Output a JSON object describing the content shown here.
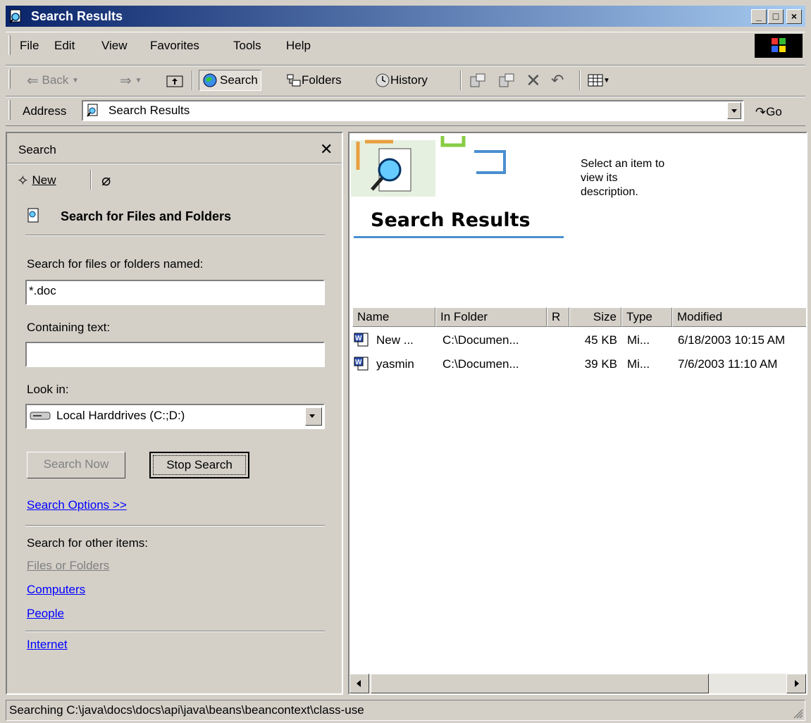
{
  "window": {
    "title": "Search Results",
    "minimize_icon": "minimize-icon",
    "maximize_icon": "maximize-icon",
    "close_icon": "close-icon"
  },
  "menu": [
    "File",
    "Edit",
    "View",
    "Favorites",
    "Tools",
    "Help"
  ],
  "toolbar": {
    "back": "Back",
    "search": "Search",
    "folders": "Folders",
    "history": "History"
  },
  "address": {
    "label": "Address",
    "value": "Search Results",
    "go": "Go"
  },
  "search_pane": {
    "title": "Search",
    "new_label": "New",
    "heading": "Search for Files and Folders",
    "named_label": "Search for files or folders named:",
    "named_value": "*.doc",
    "containing_label": "Containing text:",
    "containing_value": "",
    "lookin_label": "Look in:",
    "lookin_value": "Local Harddrives (C:;D:)",
    "search_now": "Search Now",
    "stop_search": "Stop Search",
    "options_link": "Search Options >>",
    "other_label": "Search for other items:",
    "other_items": [
      "Files or Folders",
      "Computers",
      "People"
    ],
    "internet": "Internet"
  },
  "results": {
    "banner_title": "Search Results",
    "description": "Select an item to view its description.",
    "columns": [
      "Name",
      "In Folder",
      "R",
      "Size",
      "Type",
      "Modified"
    ],
    "rows": [
      {
        "name": "New ...",
        "folder": "C:\\Documen...",
        "size": "45 KB",
        "type": "Mi...",
        "modified": "6/18/2003 10:15 AM"
      },
      {
        "name": "yasmin",
        "folder": "C:\\Documen...",
        "size": "39 KB",
        "type": "Mi...",
        "modified": "7/6/2003 11:10 AM"
      }
    ]
  },
  "status": "Searching C:\\java\\docs\\docs\\api\\java\\beans\\beancontext\\class-use"
}
